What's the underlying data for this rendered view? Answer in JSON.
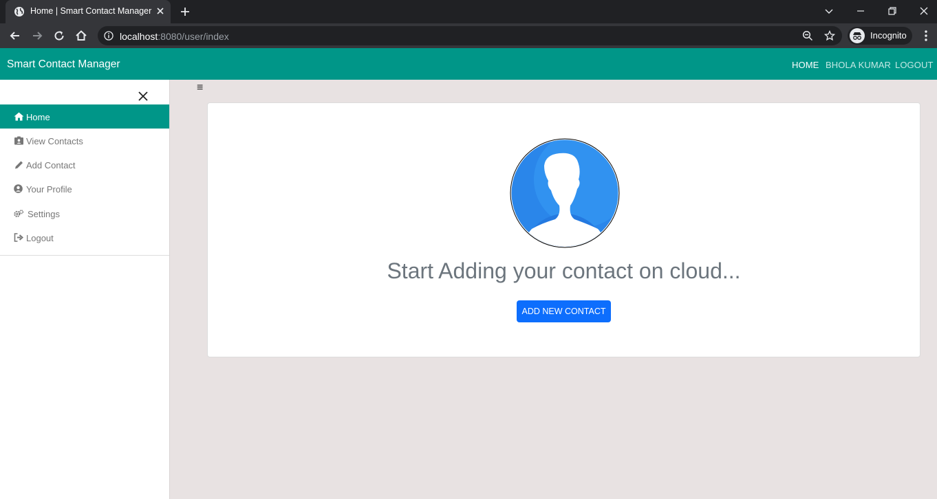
{
  "browser": {
    "tab_title": "Home | Smart Contact Manager",
    "url_host": "localhost",
    "url_rest": ":8080/user/index",
    "profile_label": "Incognito"
  },
  "navbar": {
    "brand": "Smart Contact Manager",
    "links": [
      "HOME",
      "BHOLA KUMAR",
      "LOGOUT"
    ]
  },
  "sidebar": {
    "items": [
      {
        "label": "Home",
        "icon": "home-icon",
        "active": true
      },
      {
        "label": "View Contacts",
        "icon": "address-card-icon",
        "active": false
      },
      {
        "label": "Add Contact",
        "icon": "pencil-icon",
        "active": false
      },
      {
        "label": "Your Profile",
        "icon": "user-circle-icon",
        "active": false
      },
      {
        "label": "Settings",
        "icon": "cogs-icon",
        "active": false
      },
      {
        "label": "Logout",
        "icon": "sign-out-icon",
        "active": false
      }
    ]
  },
  "content": {
    "menu_toggle": "≡",
    "headline": "Start Adding your contact on cloud...",
    "add_button": "ADD NEW CONTACT"
  },
  "colors": {
    "primary_teal": "#009688",
    "button_blue": "#0d6efd",
    "page_bg": "#e8e2e2",
    "headline_gray": "#6c757d"
  }
}
